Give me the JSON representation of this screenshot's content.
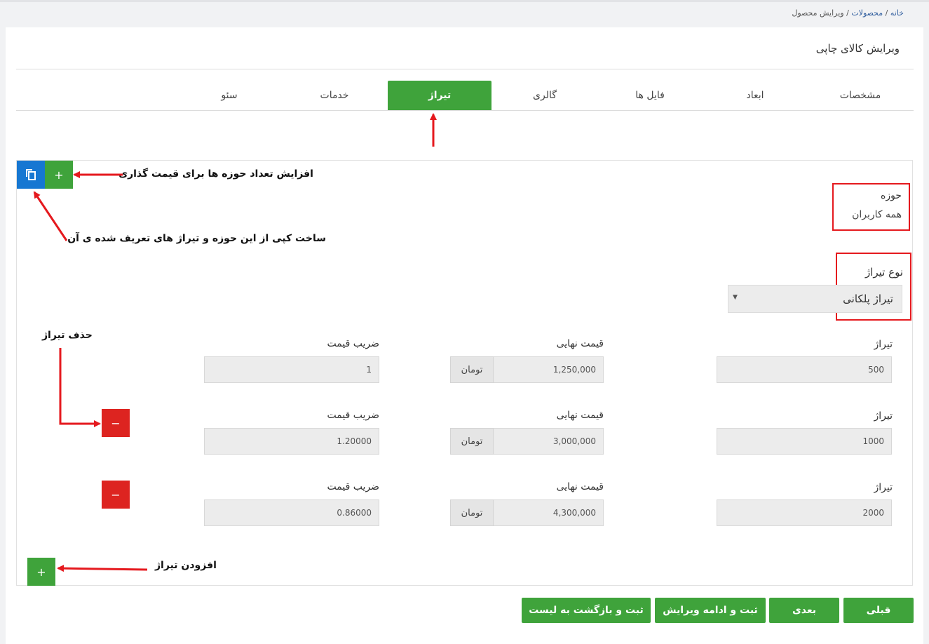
{
  "breadcrumb": {
    "home": "خانه",
    "products": "محصولات",
    "current": "ویرایش محصول"
  },
  "page_title": "ویرایش کالای چاپی",
  "tabs": [
    {
      "label": "مشخصات",
      "active": false
    },
    {
      "label": "ابعاد",
      "active": false
    },
    {
      "label": "فایل ها",
      "active": false
    },
    {
      "label": "گالری",
      "active": false
    },
    {
      "label": "تیراژ",
      "active": true
    },
    {
      "label": "خدمات",
      "active": false
    },
    {
      "label": "سئو",
      "active": false
    }
  ],
  "scope": {
    "label": "حوزه",
    "value": "همه کاربران"
  },
  "circulation_type": {
    "label": "نوع تیراژ",
    "selected": "تیراژ پلکانی"
  },
  "field_labels": {
    "circulation": "تیراژ",
    "final_price": "قیمت نهایی",
    "price_factor": "ضریب قیمت",
    "currency": "تومان"
  },
  "rows": [
    {
      "circulation": "500",
      "final_price": "1,250,000",
      "factor": "1"
    },
    {
      "circulation": "1000",
      "final_price": "3,000,000",
      "factor": "1.20000"
    },
    {
      "circulation": "2000",
      "final_price": "4,300,000",
      "factor": "0.86000"
    }
  ],
  "buttons": {
    "add": "+",
    "remove": "−",
    "prev": "قبلی",
    "next": "بعدی",
    "save_continue": "ثبت و ادامه ویرایش",
    "save_return": "ثبت و بازگشت به لیست"
  },
  "annotations": {
    "add_scope": "افزایش تعداد حوزه ها برای قیمت گذاری",
    "copy_scope": "ساخت کپی از این حوزه و تیراژ های تعریف شده ی آن",
    "remove_circulation": "حذف تیراژ",
    "add_circulation": "افزودن تیراژ"
  },
  "colors": {
    "accent_green": "#3fa33b",
    "copy_blue": "#1677d2",
    "danger_red": "#dd2420",
    "annotation_red": "#e5191e"
  },
  "icons": {
    "copy": "copy-icon",
    "add": "plus-icon",
    "remove": "minus-icon",
    "dropdown": "caret-down-icon"
  }
}
